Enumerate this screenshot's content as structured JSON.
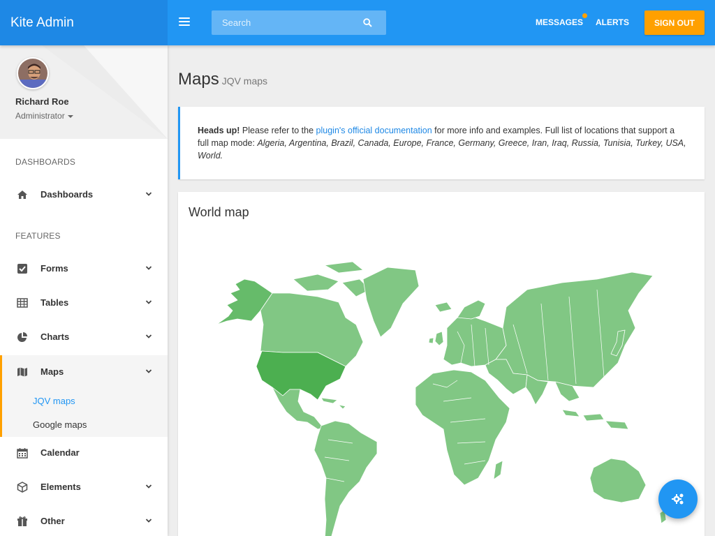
{
  "app": {
    "title": "Kite Admin"
  },
  "header": {
    "search_placeholder": "Search",
    "messages": "MESSAGES",
    "alerts": "ALERTS",
    "sign_out": "SIGN OUT"
  },
  "profile": {
    "name": "Richard Roe",
    "role": "Administrator"
  },
  "sidebar": {
    "section_dashboards": "DASHBOARDS",
    "section_features": "FEATURES",
    "items": [
      {
        "label": "Dashboards",
        "icon": "home-icon"
      },
      {
        "label": "Forms",
        "icon": "checkbox-icon"
      },
      {
        "label": "Tables",
        "icon": "table-icon"
      },
      {
        "label": "Charts",
        "icon": "pie-chart-icon"
      },
      {
        "label": "Maps",
        "icon": "map-icon"
      },
      {
        "label": "Calendar",
        "icon": "calendar-icon"
      },
      {
        "label": "Elements",
        "icon": "cube-icon"
      },
      {
        "label": "Other",
        "icon": "gift-icon"
      }
    ],
    "maps_submenu": [
      "JQV maps",
      "Google maps"
    ]
  },
  "page": {
    "title": "Maps",
    "subtitle": "JQV maps"
  },
  "callout": {
    "strong": "Heads up!",
    "text1": " Please refer to the ",
    "link": "plugin's official documentation",
    "text2": " for more info and examples. Full list of locations that support a full map mode: ",
    "locations": "Algeria, Argentina, Brazil, Canada, Europe, France, Germany, Greece, Iran, Iraq, Russia, Tunisia, Turkey, USA, World",
    "end": "."
  },
  "map_card": {
    "title": "World map"
  },
  "colors": {
    "primary": "#2196f3",
    "primary_dark": "#1e88e5",
    "accent": "#ffa000",
    "map_fill": "#81c784",
    "map_highlight": "#4caf50",
    "link": "#1e88e5"
  }
}
